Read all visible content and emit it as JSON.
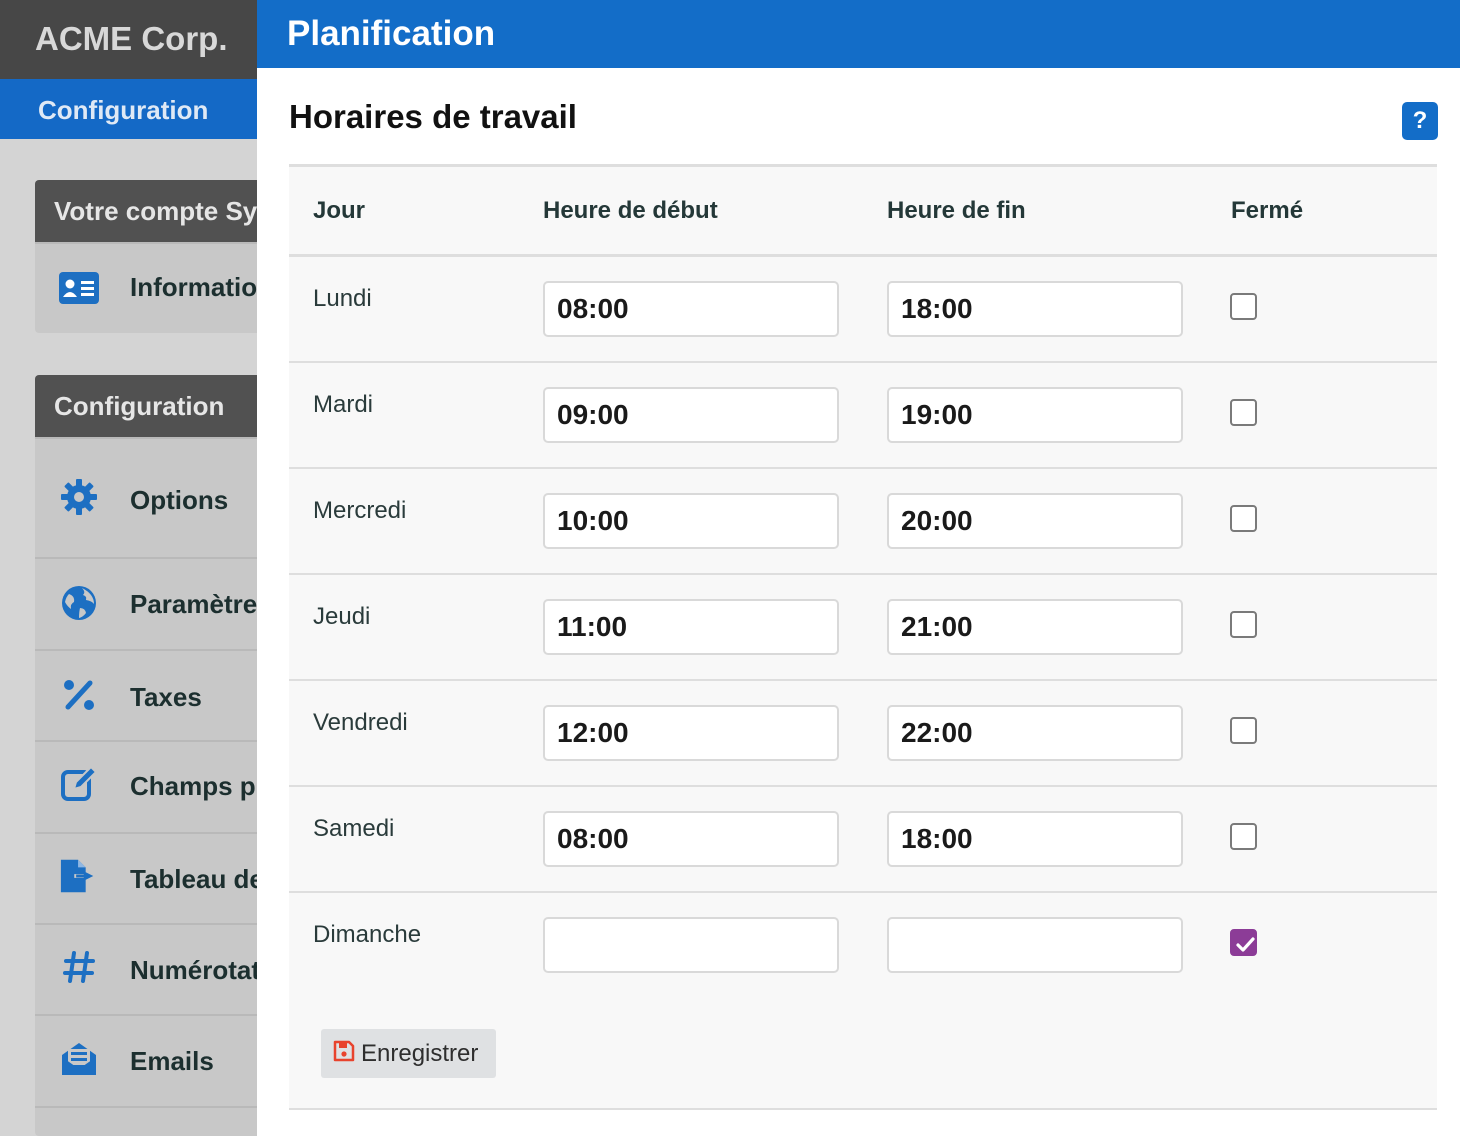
{
  "brand": "ACME Corp.",
  "nav": {
    "active_section": "Configuration"
  },
  "sidebar": {
    "account_panel": {
      "title": "Votre compte Sy",
      "items": [
        {
          "label": "Informatio",
          "icon": "id-card-icon"
        }
      ]
    },
    "config_panel": {
      "title": "Configuration",
      "items": [
        {
          "label": "Options",
          "icon": "gear-icon"
        },
        {
          "label": "Paramètre",
          "icon": "globe-icon"
        },
        {
          "label": "Taxes",
          "icon": "percent-icon"
        },
        {
          "label": "Champs p",
          "icon": "edit-icon"
        },
        {
          "label": "Tableau de",
          "icon": "file-export-icon"
        },
        {
          "label": "Numérotat",
          "icon": "hashtag-icon"
        },
        {
          "label": "Emails",
          "icon": "envelope-icon"
        }
      ]
    }
  },
  "page": {
    "title": "Planification",
    "section_title": "Horaires de travail",
    "help_label": "?"
  },
  "table": {
    "headers": {
      "day": "Jour",
      "start": "Heure de début",
      "end": "Heure de fin",
      "closed": "Fermé"
    },
    "rows": [
      {
        "day": "Lundi",
        "start": "08:00",
        "end": "18:00",
        "closed": false
      },
      {
        "day": "Mardi",
        "start": "09:00",
        "end": "19:00",
        "closed": false
      },
      {
        "day": "Mercredi",
        "start": "10:00",
        "end": "20:00",
        "closed": false
      },
      {
        "day": "Jeudi",
        "start": "11:00",
        "end": "21:00",
        "closed": false
      },
      {
        "day": "Vendredi",
        "start": "12:00",
        "end": "22:00",
        "closed": false
      },
      {
        "day": "Samedi",
        "start": "08:00",
        "end": "18:00",
        "closed": false
      },
      {
        "day": "Dimanche",
        "start": "",
        "end": "",
        "closed": true
      }
    ]
  },
  "save_button": {
    "label": "Enregistrer",
    "icon": "floppy-disk-icon"
  },
  "colors": {
    "brand_blue": "#136dc8",
    "checkbox_checked": "#8c3c97",
    "save_icon": "#e8432d"
  }
}
